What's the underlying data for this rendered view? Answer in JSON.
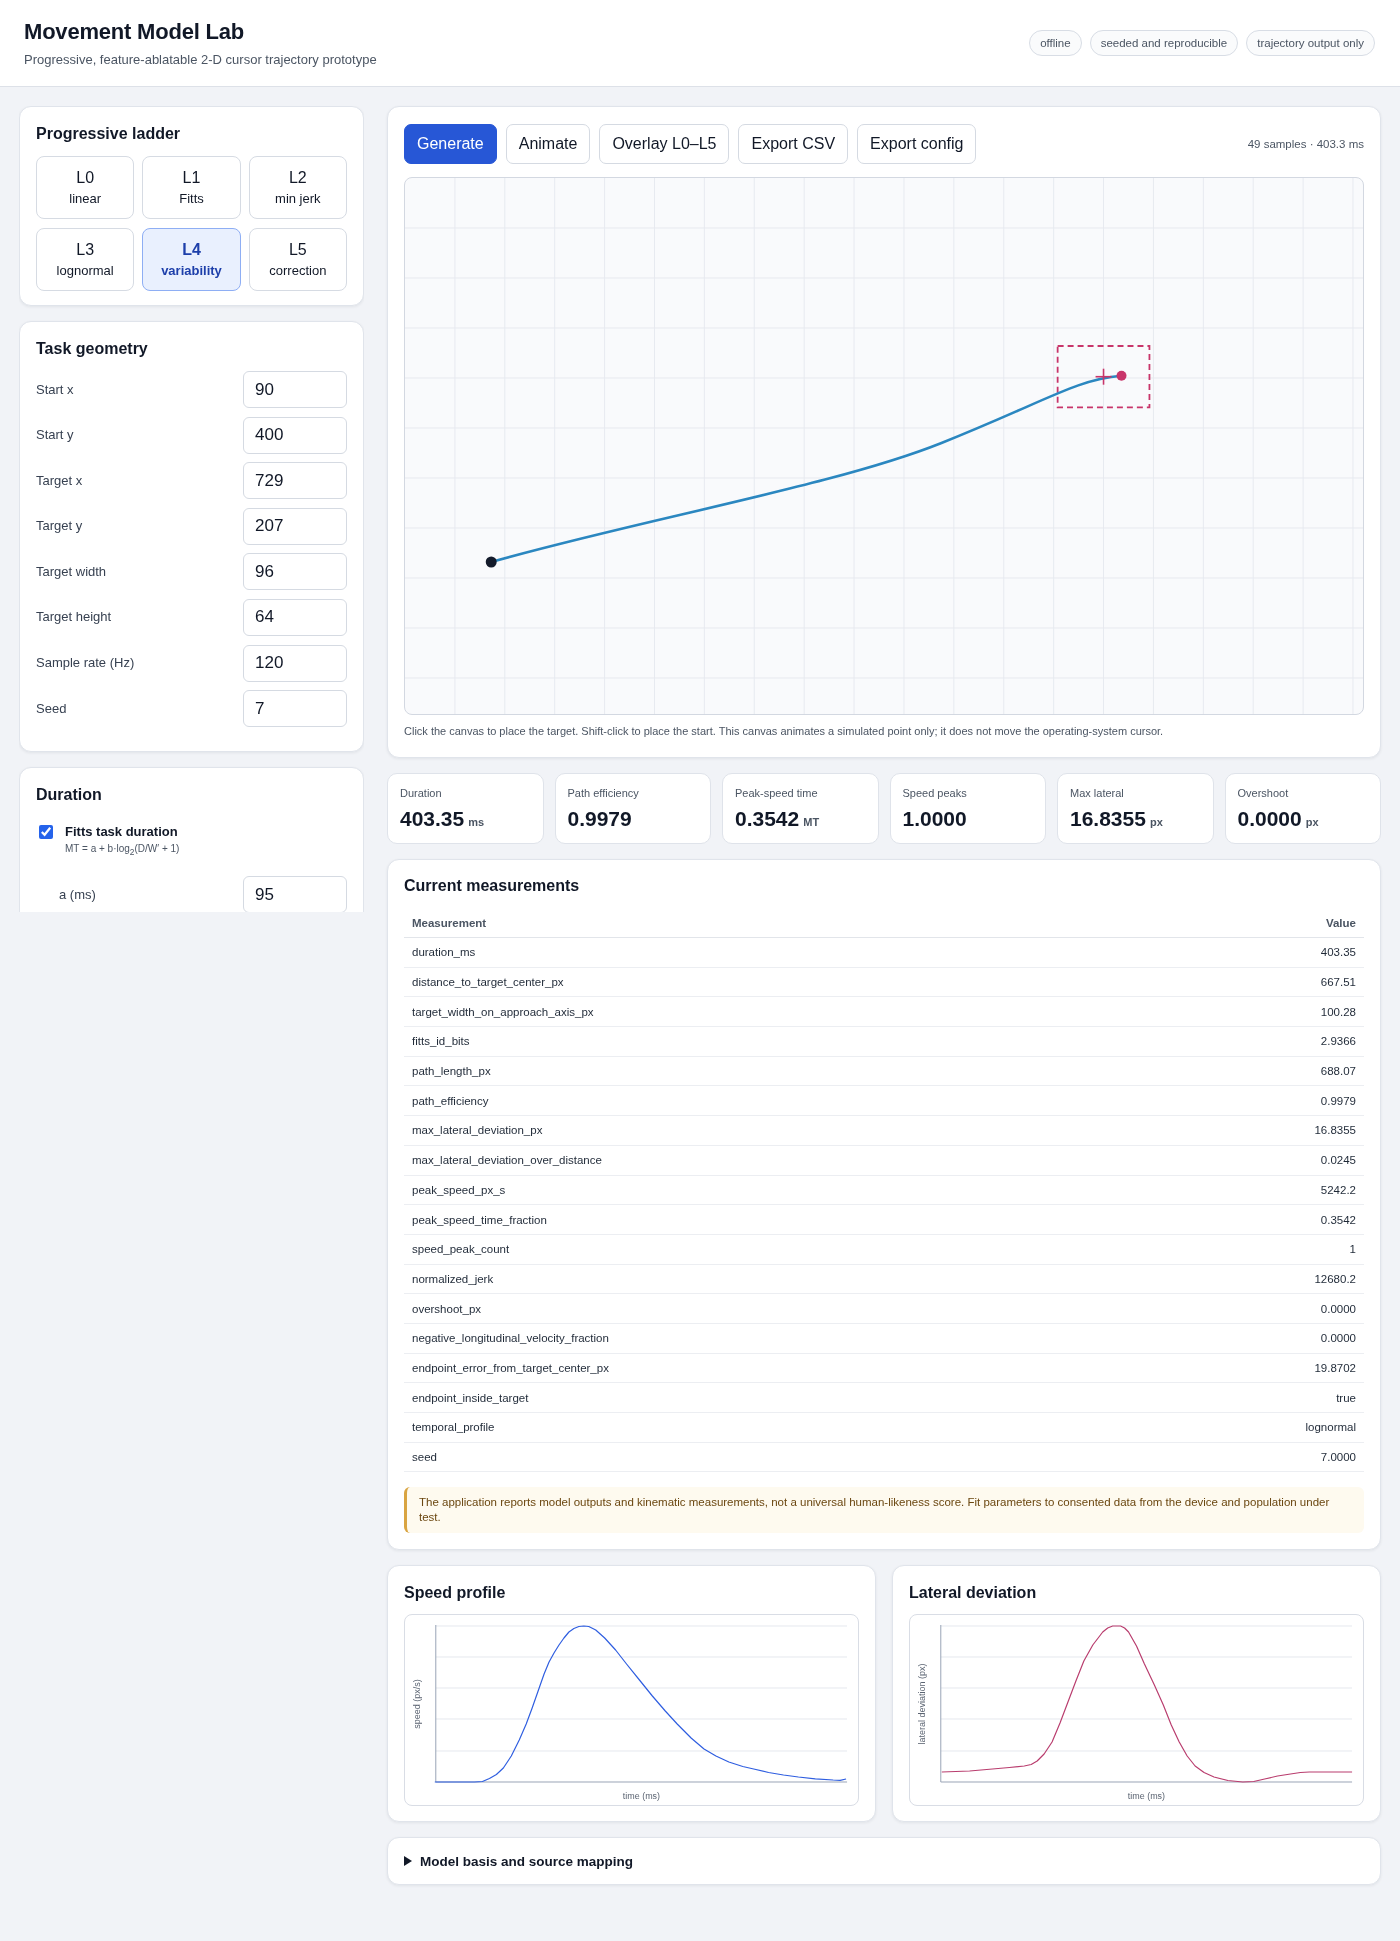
{
  "header": {
    "title": "Movement Model Lab",
    "subtitle": "Progressive, feature-ablatable 2-D cursor trajectory prototype",
    "tags": [
      "offline",
      "seeded and reproducible",
      "trajectory output only"
    ]
  },
  "sidebar": {
    "ladder": {
      "title": "Progressive ladder",
      "levels": [
        {
          "level": "L0",
          "name": "linear",
          "selected": false
        },
        {
          "level": "L1",
          "name": "Fitts",
          "selected": false
        },
        {
          "level": "L2",
          "name": "min jerk",
          "selected": false
        },
        {
          "level": "L3",
          "name": "lognormal",
          "selected": false
        },
        {
          "level": "L4",
          "name": "variability",
          "selected": true
        },
        {
          "level": "L5",
          "name": "correction",
          "selected": false
        }
      ]
    },
    "geometry": {
      "title": "Task geometry",
      "fields": [
        {
          "label": "Start x",
          "value": "90"
        },
        {
          "label": "Start y",
          "value": "400"
        },
        {
          "label": "Target x",
          "value": "729"
        },
        {
          "label": "Target y",
          "value": "207"
        },
        {
          "label": "Target width",
          "value": "96"
        },
        {
          "label": "Target height",
          "value": "64"
        },
        {
          "label": "Sample rate (Hz)",
          "value": "120"
        },
        {
          "label": "Seed",
          "value": "7"
        }
      ]
    },
    "duration": {
      "title": "Duration",
      "options": [
        {
          "label": "Fitts task duration",
          "formula": "MT = a + b·log$_{2}$(D/W′ + 1)",
          "checked": true
        }
      ],
      "fields": [
        {
          "label": "a (ms)",
          "value": "95"
        }
      ]
    }
  },
  "workspace": {
    "buttons": [
      {
        "label": "Generate",
        "kind": "primary"
      },
      {
        "label": "Animate",
        "kind": "secondary"
      },
      {
        "label": "Overlay L0–L5",
        "kind": "secondary"
      },
      {
        "label": "Export CSV",
        "kind": "secondary"
      },
      {
        "label": "Export config",
        "kind": "secondary"
      }
    ],
    "summary": "49 samples · 403.3 ms",
    "caption": "Click the canvas to place the target. Shift-click to place the start. This canvas animates a simulated point only; it does not move the operating-system cursor."
  },
  "metrics": [
    {
      "label": "Duration",
      "value": "403.35",
      "unit": "ms"
    },
    {
      "label": "Path efficiency",
      "value": "0.9979"
    },
    {
      "label": "Peak-speed time",
      "value": "0.3542",
      "unit": "MT"
    },
    {
      "label": "Speed peaks",
      "value": "1.0000"
    },
    {
      "label": "Max lateral",
      "value": "16.8355",
      "unit": "px"
    },
    {
      "label": "Overshoot",
      "value": "0.0000",
      "unit": "px"
    }
  ],
  "measurements": {
    "title": "Current measurements",
    "columns": [
      "Measurement",
      "Value"
    ],
    "rows": [
      [
        "duration_ms",
        "403.35"
      ],
      [
        "distance_to_target_center_px",
        "667.51"
      ],
      [
        "target_width_on_approach_axis_px",
        "100.28"
      ],
      [
        "fitts_id_bits",
        "2.9366"
      ],
      [
        "path_length_px",
        "688.07"
      ],
      [
        "path_efficiency",
        "0.9979"
      ],
      [
        "max_lateral_deviation_px",
        "16.8355"
      ],
      [
        "max_lateral_deviation_over_distance",
        "0.0245"
      ],
      [
        "peak_speed_px_s",
        "5242.2"
      ],
      [
        "peak_speed_time_fraction",
        "0.3542"
      ],
      [
        "speed_peak_count",
        "1"
      ],
      [
        "normalized_jerk",
        "12680.2"
      ],
      [
        "overshoot_px",
        "0.0000"
      ],
      [
        "negative_longitudinal_velocity_fraction",
        "0.0000"
      ],
      [
        "endpoint_error_from_target_center_px",
        "19.8702"
      ],
      [
        "endpoint_inside_target",
        "true"
      ],
      [
        "temporal_profile",
        "lognormal"
      ],
      [
        "seed",
        "7.0000"
      ]
    ],
    "notice": "The application reports model outputs and kinematic measurements, not a universal human-likeness score. Fit parameters to consented data from the device and population under test."
  },
  "charts": [
    {
      "title": "Speed profile",
      "kind": "speed",
      "ylabel": "speed (px/s)",
      "xlabel": "time (ms)"
    },
    {
      "title": "Lateral deviation",
      "kind": "lateral",
      "ylabel": "lateral deviation (px)",
      "xlabel": "time (ms)"
    }
  ],
  "details": {
    "title": "Model basis and source mapping",
    "expanded": false
  }
}
